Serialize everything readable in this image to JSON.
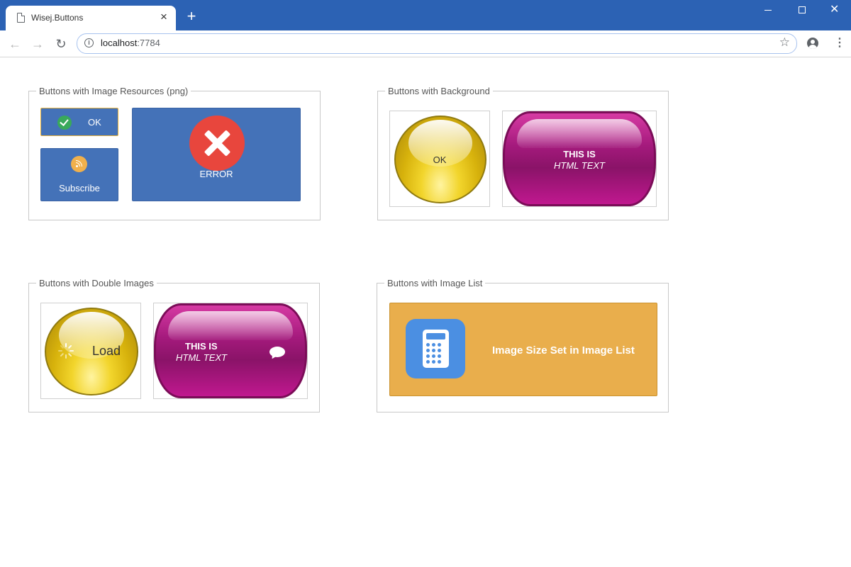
{
  "browser": {
    "tab_title": "Wisej.Buttons",
    "url_host": "localhost",
    "url_port": ":7784",
    "icons": {
      "back": "arrow-left",
      "forward": "arrow-right",
      "reload": "reload",
      "info": "info-circle",
      "star": "star-outline",
      "profile": "account-circle",
      "menu": "vertical-dots"
    }
  },
  "groups": {
    "image_resources": {
      "legend": "Buttons with Image Resources (png)",
      "ok_label": "OK",
      "subscribe_label": "Subscribe",
      "error_label": "ERROR"
    },
    "background": {
      "legend": "Buttons with Background",
      "orb_label": "OK",
      "pill_line1": "THIS IS",
      "pill_line2": "HTML TEXT"
    },
    "double_images": {
      "legend": "Buttons with Double Images",
      "orb_label": "Load",
      "pill_line1": "THIS IS",
      "pill_line2": "HTML TEXT"
    },
    "image_list": {
      "legend": "Buttons with Image List",
      "button_label": "Image Size Set in Image List"
    }
  },
  "colors": {
    "chrome_blue": "#2c62b4",
    "button_blue": "#4472b8",
    "button_orange": "#e9ae4c",
    "error_red": "#e8463d",
    "check_green": "#39a95b",
    "rss_orange": "#f0b04c",
    "calc_blue": "#4b8fe2"
  }
}
